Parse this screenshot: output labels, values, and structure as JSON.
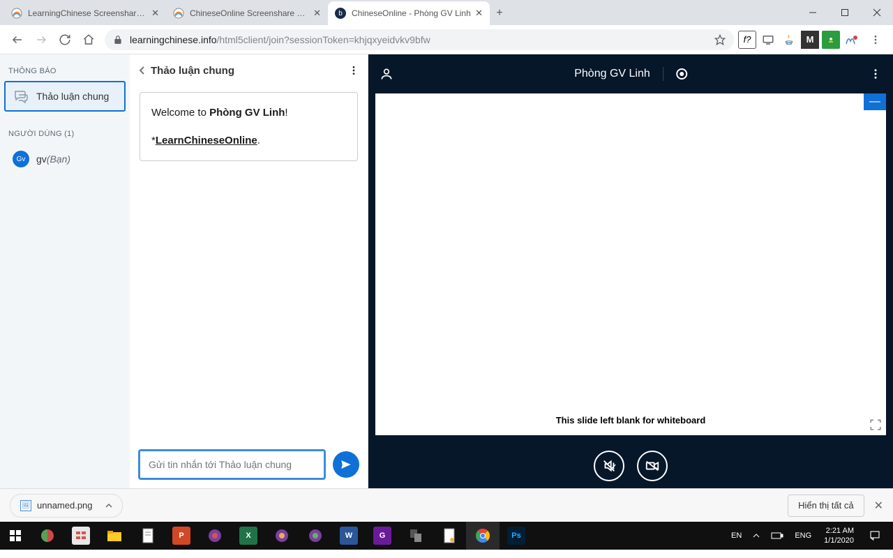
{
  "browser": {
    "tabs": [
      {
        "title": "LearningChinese Screenshare Ext"
      },
      {
        "title": "ChineseOnline Screenshare Exten"
      },
      {
        "title": "ChineseOnline - Phòng GV Linh"
      }
    ],
    "url_host": "learningchinese.info",
    "url_path": "/html5client/join?sessionToken=khjqxyeidvkv9bfw",
    "fx_icon": "f?"
  },
  "sidebar": {
    "notices_heading": "THÔNG BÁO",
    "chat_item": "Thảo luận chung",
    "users_heading": "NGƯỜI DÙNG (1)",
    "user_initials": "Gv",
    "user_name": "gv",
    "user_you": " (Bạn)"
  },
  "chat": {
    "title": "Thảo luận chung",
    "welcome_prefix": "Welcome to ",
    "welcome_room": "Phòng GV Linh",
    "welcome_suffix": "!",
    "welcome_star": "*",
    "welcome_link": "LearnChineseOnline",
    "welcome_dot": ".",
    "placeholder": "Gửi tin nhắn tới Thảo luận chung"
  },
  "presentation": {
    "room_title": "Phòng GV Linh",
    "slide_caption": "This slide left blank for whiteboard",
    "minimize": "—"
  },
  "download": {
    "filename": "unnamed.png",
    "show_all": "Hiển thị tất cả"
  },
  "taskbar": {
    "lang_short": "EN",
    "lang_long": "ENG",
    "time": "2:21 AM",
    "date": "1/1/2020"
  }
}
